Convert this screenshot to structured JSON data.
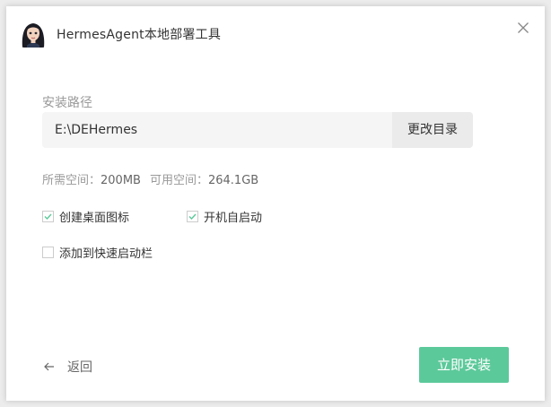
{
  "window": {
    "title": "HermesAgent本地部署工具",
    "avatar_icon": "girl-avatar-icon",
    "close_icon": "close-icon"
  },
  "install": {
    "path_label": "安装路径",
    "path_value": "E:\\DEHermes",
    "change_dir_label": "更改目录",
    "required_space_label": "所需空间：",
    "required_space_value": "200MB",
    "available_space_label": "可用空间：",
    "available_space_value": "264.1GB"
  },
  "options": [
    {
      "label": "创建桌面图标",
      "checked": true
    },
    {
      "label": "开机自启动",
      "checked": true
    },
    {
      "label": "添加到快速启动栏",
      "checked": false
    }
  ],
  "footer": {
    "back_label": "返回",
    "install_label": "立即安装"
  },
  "colors": {
    "accent": "#5cc99a",
    "check": "#5cc99a"
  }
}
